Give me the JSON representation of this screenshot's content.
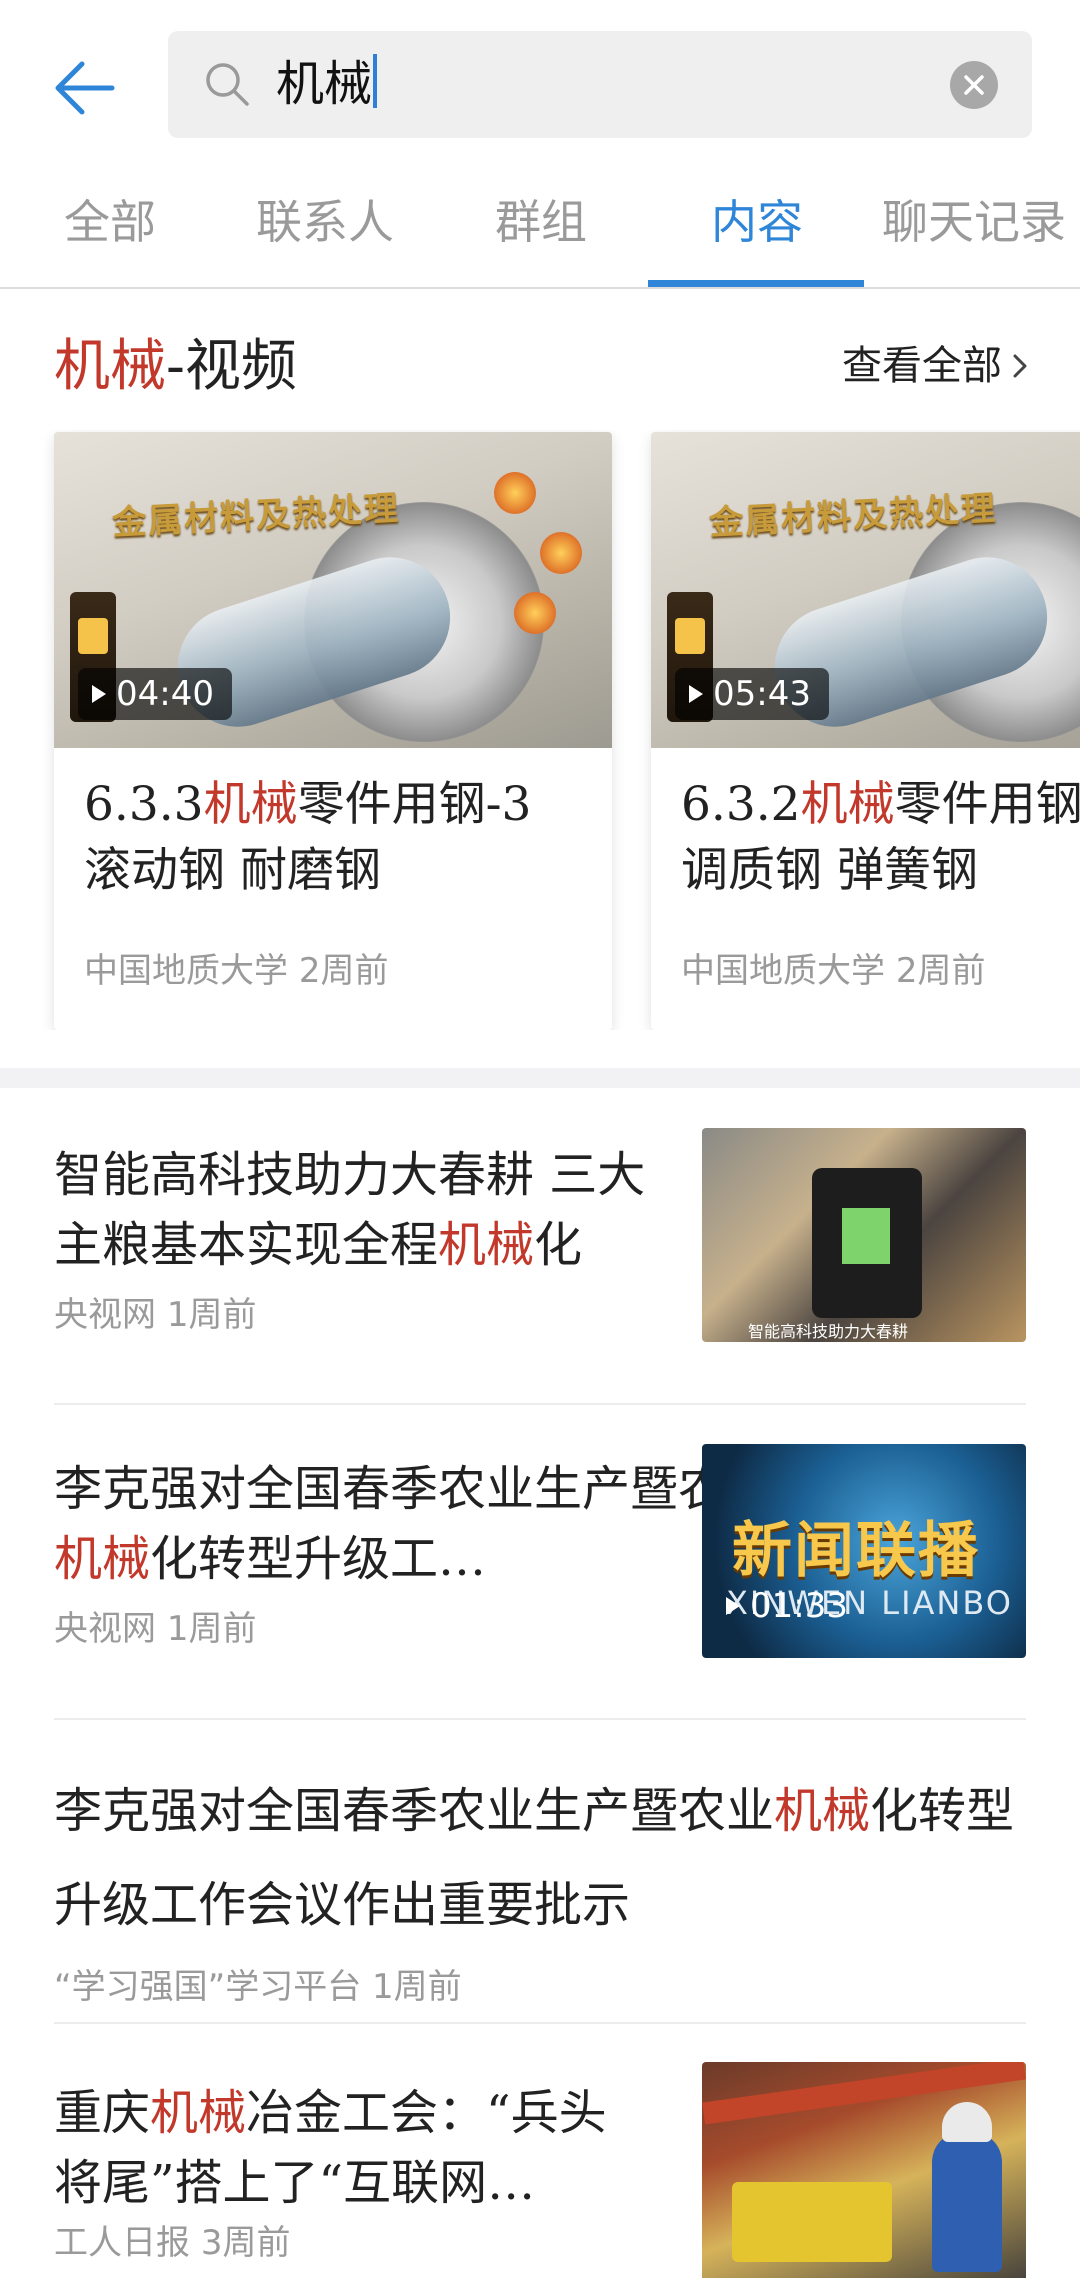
{
  "search": {
    "query": "机械",
    "back_icon": "arrow-left-icon",
    "search_icon": "search-icon",
    "clear_icon": "close-circle-icon"
  },
  "tabs": [
    {
      "label": "全部",
      "active": false
    },
    {
      "label": "联系人",
      "active": false
    },
    {
      "label": "群组",
      "active": false
    },
    {
      "label": "内容",
      "active": true
    },
    {
      "label": "聊天记录",
      "active": false
    }
  ],
  "colors": {
    "accent": "#2f86d8",
    "highlight": "#c2392b",
    "muted_text": "#9a9a9a"
  },
  "video_section": {
    "title_keyword": "机械",
    "title_rest": "-视频",
    "view_all": "查看全部",
    "chevron_icon": "chevron-right-icon"
  },
  "videos": [
    {
      "thumb_banner": "金属材料及热处理",
      "duration": "04:40",
      "title_prefix": "6.3.3",
      "title_keyword": "机械",
      "title_line1_rest": "零件用钢-3",
      "title_line2": "滚动钢 耐磨钢",
      "source": "中国地质大学",
      "time": "2周前"
    },
    {
      "thumb_banner": "金属材料及热处理",
      "duration": "05:43",
      "title_prefix": "6.3.2",
      "title_keyword": "机械",
      "title_line1_rest": "零件用钢",
      "title_line2": "调质钢 弹簧钢",
      "source": "中国地质大学",
      "time": "2周前"
    }
  ],
  "articles": [
    {
      "title_before": "智能高科技助力大春耕 三大主粮基本实现全程",
      "title_keyword": "机械",
      "title_after": "化",
      "source": "央视网",
      "time": "1周前",
      "thumb_caption": "智能高科技助力大春耕"
    },
    {
      "title_before": "李克强对全国春季农业生产暨农业",
      "title_keyword": "机械",
      "title_after": "化转型升级工…",
      "source": "央视网",
      "time": "1周前",
      "thumb_brand": "新闻联播",
      "thumb_sub": "XINWEN LIANBO",
      "duration": "01:33"
    },
    {
      "title_before": "李克强对全国春季农业生产暨农业",
      "title_keyword": "机械",
      "title_after": "化转型升级工作会议作出重要批示",
      "source": "“学习强国”学习平台",
      "time": "1周前"
    },
    {
      "title_before": "重庆",
      "title_keyword": "机械",
      "title_after": "冶金工会：“兵头将尾”搭上了“互联网…",
      "source": "工人日报",
      "time": "3周前"
    }
  ]
}
